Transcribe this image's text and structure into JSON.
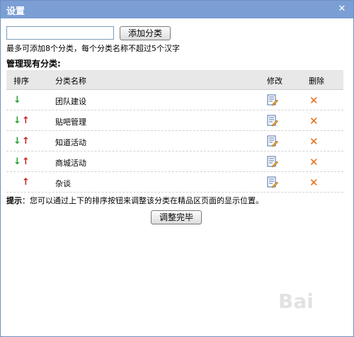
{
  "window": {
    "title": "设置",
    "close_icon": "close-icon (×)"
  },
  "add": {
    "input_value": "",
    "input_placeholder": "",
    "button_label": "添加分类",
    "hint": "最多可添加8个分类，每个分类名称不超过5个汉字"
  },
  "manage": {
    "title": "管理现有分类:",
    "headers": {
      "sort": "排序",
      "name": "分类名称",
      "edit": "修改",
      "delete": "删除"
    },
    "rows": [
      {
        "name": "团队建设",
        "down": true,
        "up": false
      },
      {
        "name": "贴吧管理",
        "down": true,
        "up": true
      },
      {
        "name": "知道活动",
        "down": true,
        "up": true
      },
      {
        "name": "商城活动",
        "down": true,
        "up": true
      },
      {
        "name": "杂谈",
        "down": false,
        "up": true
      }
    ]
  },
  "tip": {
    "label": "提示",
    "text": "：您可以通过上下的排序按钮来调整该分类在精品区页面的显示位置。"
  },
  "done_button_label": "调整完毕",
  "icons": {
    "down": "arrow-down-icon",
    "up": "arrow-up-icon",
    "edit": "edit-icon",
    "delete": "delete-icon"
  },
  "colors": {
    "titlebar": "#7b9ed5",
    "down_arrow": "#2a9d36",
    "up_arrow": "#c62020",
    "delete": "#e36a10"
  }
}
